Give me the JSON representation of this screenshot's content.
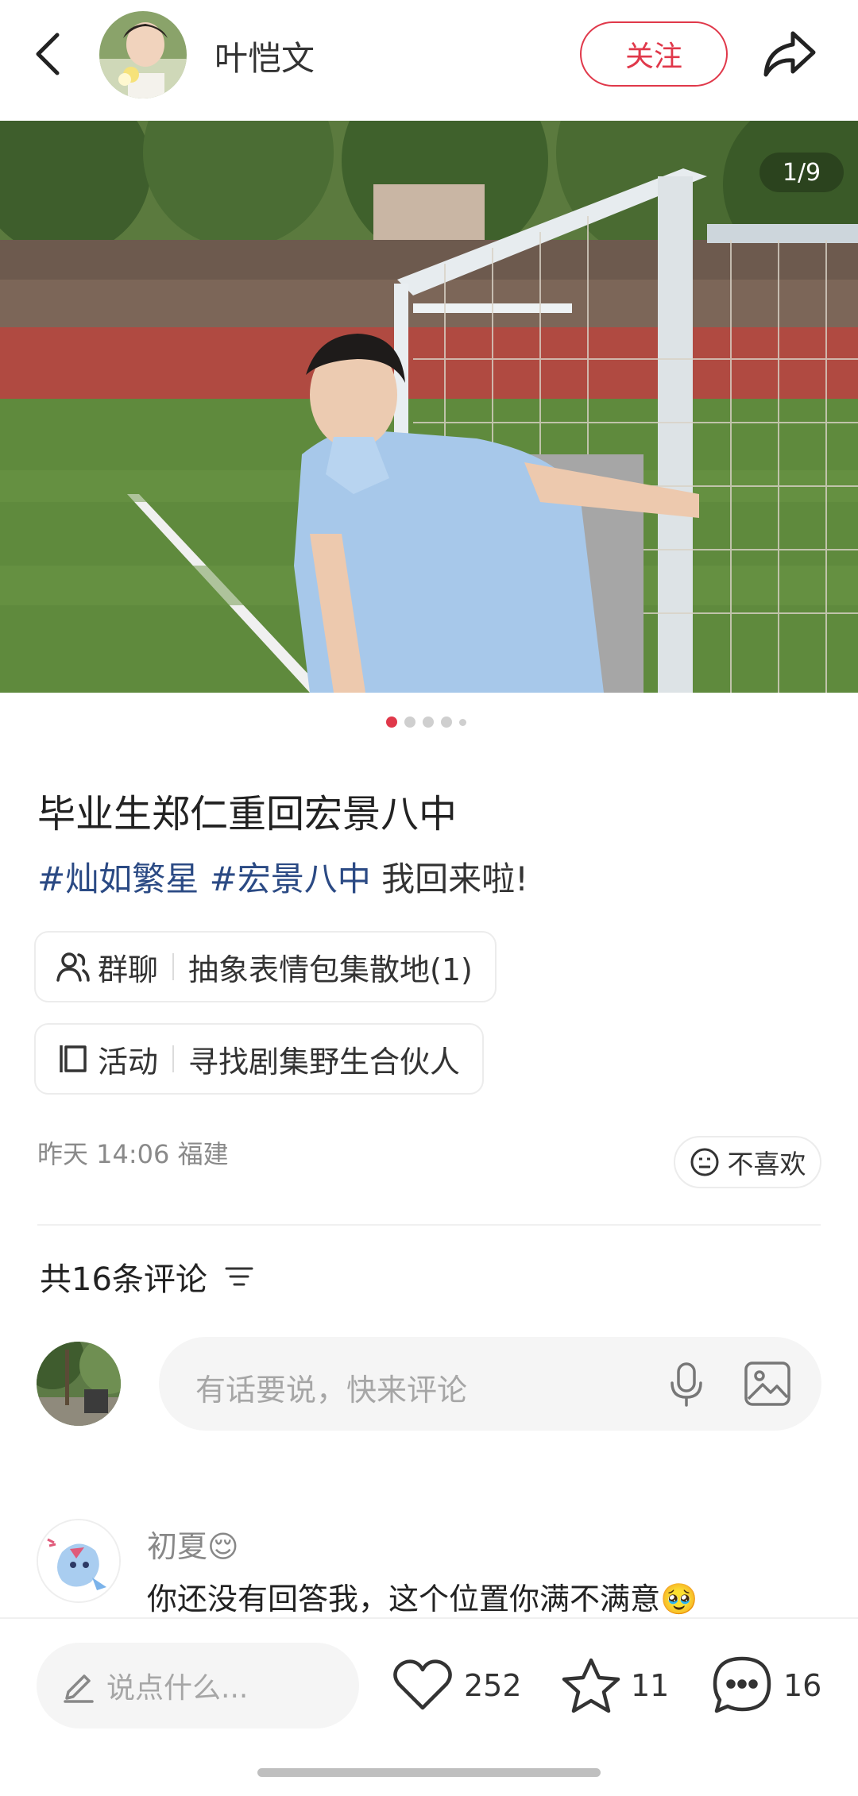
{
  "header": {
    "author_name": "叶恺文",
    "follow_label": "关注"
  },
  "photo": {
    "counter": "1/9",
    "dots_total": 5,
    "active_index": 0
  },
  "post": {
    "title": "毕业生郑仁重回宏景八中",
    "tags": [
      "#灿如繁星",
      "#宏景八中"
    ],
    "text": "我回来啦!"
  },
  "chips": [
    {
      "type": "群聊",
      "text": "抽象表情包集散地(1)",
      "icon": "group-chat-icon"
    },
    {
      "type": "活动",
      "text": "寻找剧集野生合伙人",
      "icon": "activity-icon"
    }
  ],
  "meta": {
    "time_location": "昨天 14:06 福建",
    "dislike_label": "不喜欢"
  },
  "comments": {
    "count_label": "共16条评论",
    "input_placeholder": "有话要说，快来评论",
    "items": [
      {
        "user": "初夏😌",
        "text": "你还没有回答我，这个位置你满不满意🥹"
      }
    ]
  },
  "bottom": {
    "input_placeholder": "说点什么...",
    "likes": "252",
    "collects": "11",
    "comments": "16"
  },
  "colors": {
    "accent": "#e0384a",
    "tag": "#2b4a84"
  }
}
